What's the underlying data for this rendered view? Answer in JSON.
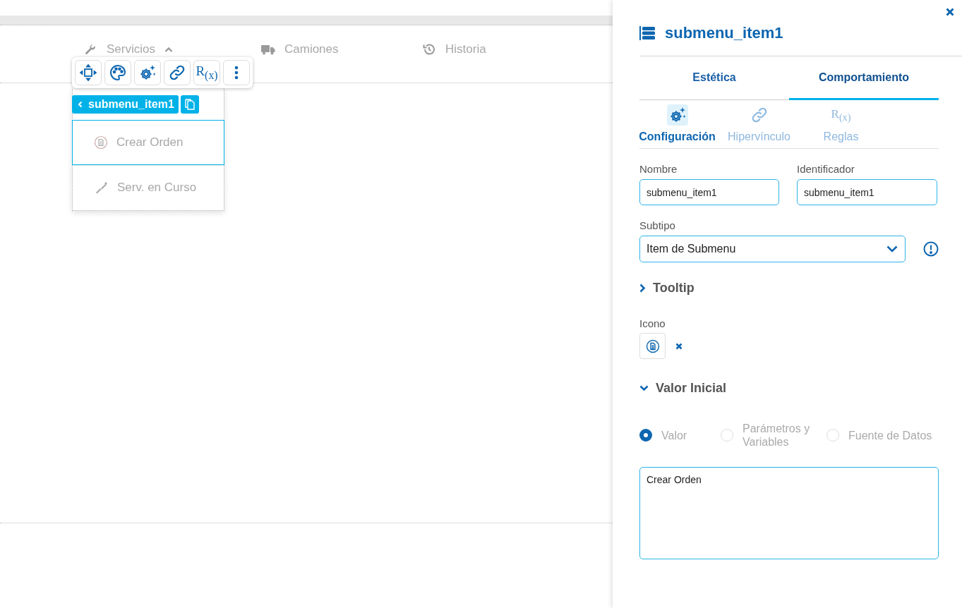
{
  "canvas": {
    "nav": [
      {
        "label": "Servicios",
        "expanded": true
      },
      {
        "label": "Camiones",
        "expanded": false
      },
      {
        "label": "Historia",
        "expanded": false
      }
    ],
    "toolbar": [
      {
        "kind": "move"
      },
      {
        "kind": "palette"
      },
      {
        "kind": "settings"
      },
      {
        "kind": "link"
      },
      {
        "kind": "rules",
        "symbol": "R$_{(x)}$"
      },
      {
        "kind": "more"
      }
    ],
    "element_chip": {
      "label": "submenu_item1"
    },
    "submenu": [
      {
        "label": "Crear Orden",
        "selected": true
      },
      {
        "label": "Serv. en Curso",
        "selected": false
      }
    ]
  },
  "panel": {
    "title": "submenu_item1",
    "tabs": [
      {
        "label": "Estética",
        "selected": false
      },
      {
        "label": "Comportamiento",
        "selected": true
      }
    ],
    "subtabs": [
      {
        "kind": "settings",
        "label": "Configuración",
        "selected": true
      },
      {
        "kind": "link",
        "label": "Hipervínculo",
        "selected": false
      },
      {
        "kind": "rules",
        "symbol": "R$_{(x)}$",
        "label": "Reglas",
        "selected": false
      }
    ],
    "fields": [
      {
        "label": "Nombre",
        "value": "submenu_item1"
      },
      {
        "label": "Identificador",
        "value": "submenu_item1"
      }
    ],
    "subtype": {
      "label": "Subtipo",
      "value": "Item de Submenu"
    },
    "tooltip": {
      "label": "Tooltip",
      "expanded": false
    },
    "icon_field": {
      "label": "Icono"
    },
    "initial_value": {
      "label": "Valor Inicial",
      "expanded": true,
      "options": [
        {
          "label": "Valor",
          "selected": true
        },
        {
          "label": "Parámetros y Variables",
          "selected": false
        },
        {
          "label": "Fuente de Datos",
          "selected": false
        }
      ],
      "value": "Crear Orden"
    }
  }
}
